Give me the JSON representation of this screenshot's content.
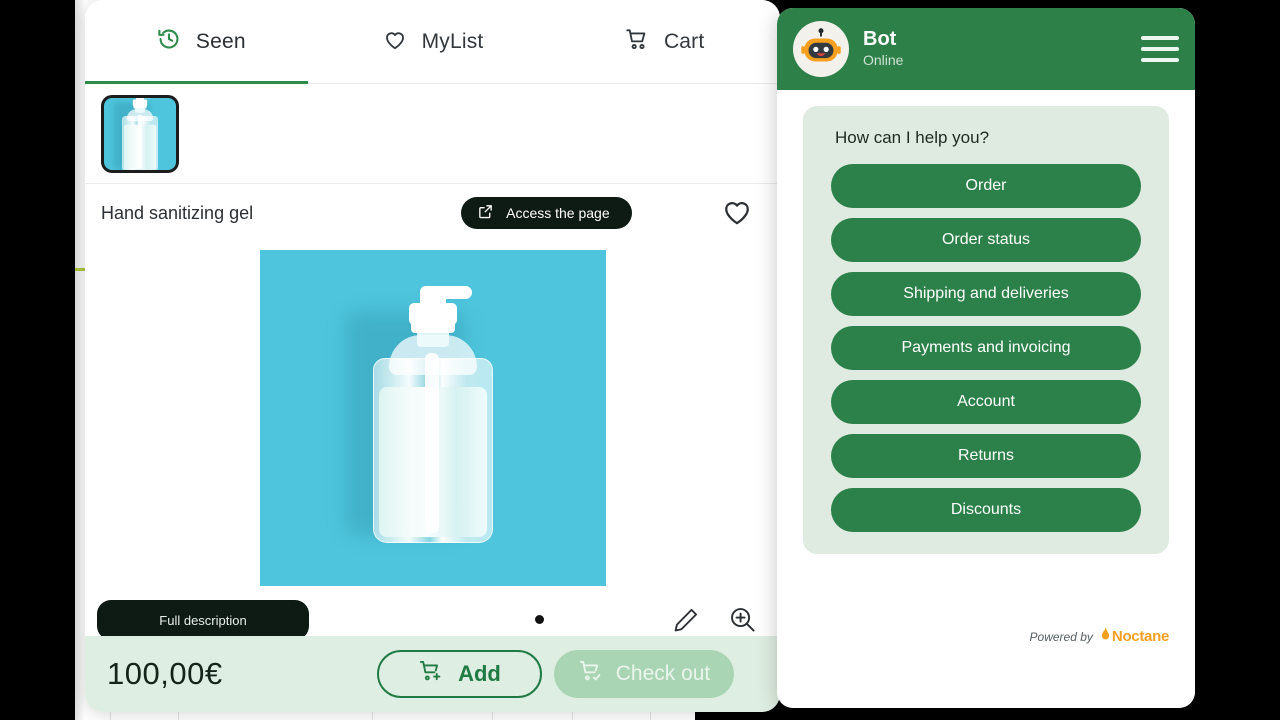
{
  "product_panel": {
    "tabs": [
      {
        "label": "Seen",
        "icon": "history-clock-icon",
        "active": true
      },
      {
        "label": "MyList",
        "icon": "heart-icon",
        "active": false
      },
      {
        "label": "Cart",
        "icon": "cart-icon",
        "active": false
      }
    ],
    "thumbnail": {
      "alt": "Hand sanitizing gel thumbnail",
      "selected": true
    },
    "title": "Hand sanitizing gel",
    "access_button": {
      "label": "Access the page",
      "icon": "external-link-icon"
    },
    "favorite_icon": "heart-outline-icon",
    "hero_image": {
      "alt": "Clear pump bottle of hand sanitizing gel on teal background",
      "background_color": "#4EC5DC"
    },
    "carousel": {
      "dots": 1,
      "active_index": 0
    },
    "edit_icon": "pencil-icon",
    "zoom_icon": "magnifier-plus-icon",
    "full_description_button": "Full description",
    "buy_bar": {
      "price": "100,00€",
      "add_button": {
        "label": "Add",
        "icon": "cart-plus-icon"
      },
      "checkout_button": {
        "label": "Check out",
        "icon": "cart-check-icon",
        "disabled": true
      }
    }
  },
  "chat_widget": {
    "header": {
      "avatar_icon": "robot-avatar-icon",
      "name": "Bot",
      "status": "Online",
      "menu_icon": "hamburger-menu-icon"
    },
    "prompt": "How can I help you?",
    "options": [
      "Order",
      "Order status",
      "Shipping and deliveries",
      "Payments and invoicing",
      "Account",
      "Returns",
      "Discounts"
    ],
    "powered_by": {
      "prefix": "Powered by",
      "brand": "Noctane"
    }
  },
  "colors": {
    "header_green": "#2E8049",
    "button_green": "#2C8049",
    "chat_bubble": "#DFEBE1",
    "buy_bar": "#DFEEE2",
    "accent_orange": "#F5A01E",
    "product_teal": "#4EC5DC"
  }
}
